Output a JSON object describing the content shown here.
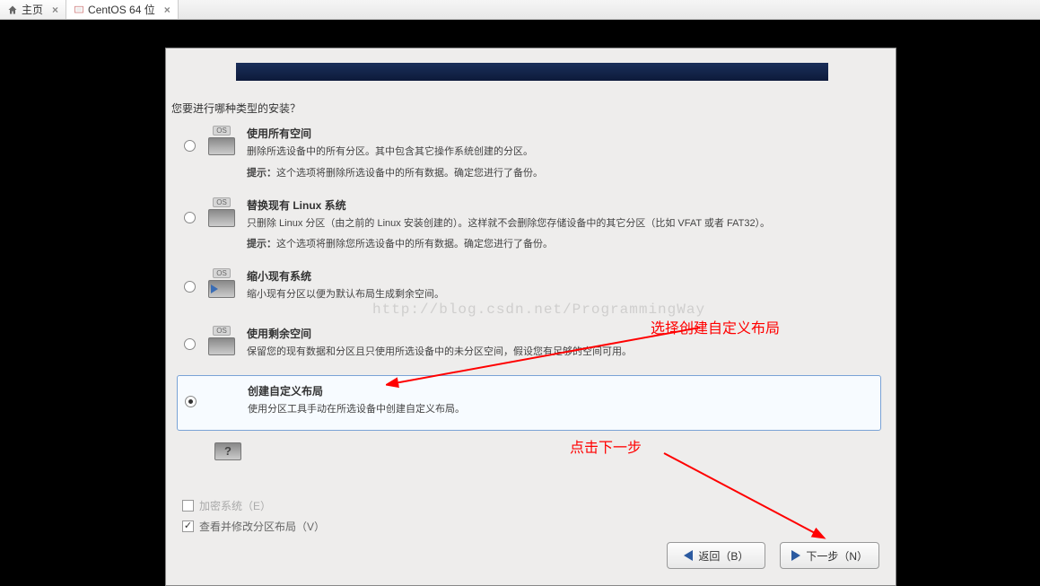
{
  "tabs": {
    "home": "主页",
    "vm": "CentOS 64 位"
  },
  "installer": {
    "question": "您要进行哪种类型的安装？",
    "options": [
      {
        "title": "使用所有空间",
        "desc": "删除所选设备中的所有分区。其中包含其它操作系统创建的分区。",
        "tip_label": "提示：",
        "tip_text": "这个选项将删除所选设备中的所有数据。确定您进行了备份。"
      },
      {
        "title": "替换现有 Linux 系统",
        "desc": "只删除 Linux 分区（由之前的 Linux 安装创建的）。这样就不会删除您存储设备中的其它分区（比如 VFAT 或者 FAT32）。",
        "tip_label": "提示：",
        "tip_text": "这个选项将删除您所选设备中的所有数据。确定您进行了备份。"
      },
      {
        "title": "缩小现有系统",
        "desc": "缩小现有分区以便为默认布局生成剩余空间。"
      },
      {
        "title": "使用剩余空间",
        "desc": "保留您的现有数据和分区且只使用所选设备中的未分区空间，假设您有足够的空间可用。"
      },
      {
        "title": "创建自定义布局",
        "desc": "使用分区工具手动在所选设备中创建自定义布局。"
      }
    ],
    "checkbox_encrypt": "加密系统（E）",
    "checkbox_review": "查看并修改分区布局（V）",
    "btn_back": "返回（B）",
    "btn_next": "下一步（N）"
  },
  "annotations": {
    "select_custom": "选择创建自定义布局",
    "click_next": "点击下一步"
  },
  "watermark": "http://blog.csdn.net/ProgrammingWay"
}
